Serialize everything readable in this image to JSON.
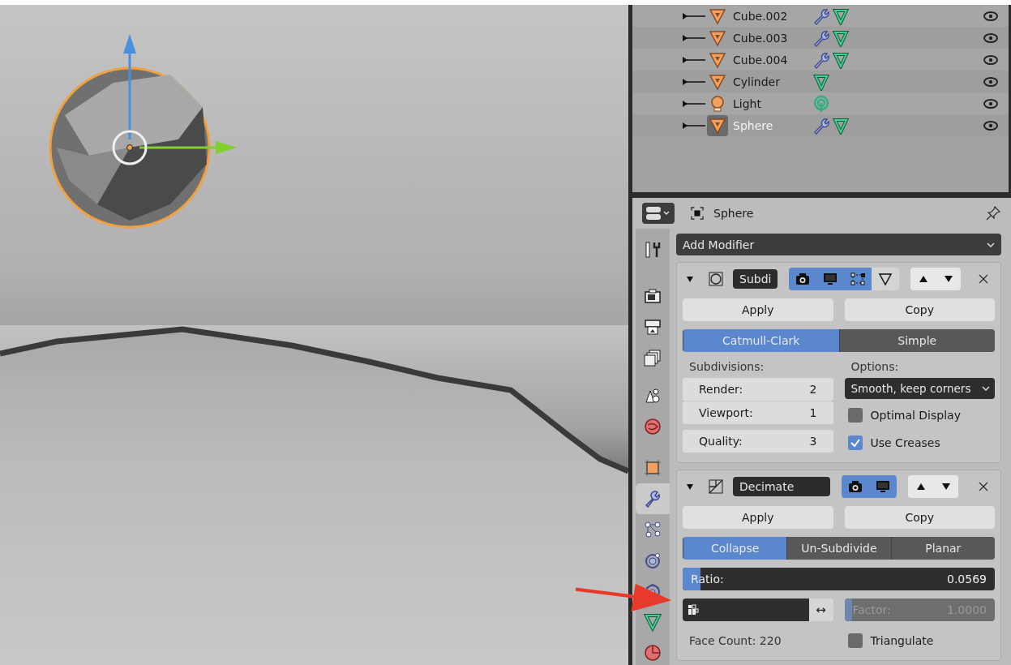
{
  "outliner": {
    "items": [
      {
        "name": "Cube.002",
        "kind": "mesh",
        "modifiers": true,
        "selected": false
      },
      {
        "name": "Cube.003",
        "kind": "mesh",
        "modifiers": true,
        "selected": false
      },
      {
        "name": "Cube.004",
        "kind": "mesh",
        "modifiers": true,
        "selected": false
      },
      {
        "name": "Cylinder",
        "kind": "mesh",
        "modifiers": false,
        "selected": false
      },
      {
        "name": "Light",
        "kind": "light",
        "modifiers": false,
        "selected": false
      },
      {
        "name": "Sphere",
        "kind": "mesh",
        "modifiers": true,
        "selected": true
      }
    ]
  },
  "properties": {
    "object_name": "Sphere",
    "tabs": [
      {
        "kind": "tool",
        "selected": false
      },
      {
        "kind": "render",
        "selected": false
      },
      {
        "kind": "output",
        "selected": false
      },
      {
        "kind": "layers",
        "selected": false
      },
      {
        "kind": "scene",
        "selected": false
      },
      {
        "kind": "world",
        "selected": false
      },
      {
        "kind": "object",
        "selected": false
      },
      {
        "kind": "modifier",
        "selected": true
      },
      {
        "kind": "particles",
        "selected": false
      },
      {
        "kind": "physics",
        "selected": false
      },
      {
        "kind": "constraint",
        "selected": false
      },
      {
        "kind": "data",
        "selected": false
      },
      {
        "kind": "material",
        "selected": false
      }
    ],
    "add_modifier": "Add Modifier",
    "modifiers": [
      {
        "kind": "subdivision",
        "name": "Subdi",
        "toggles": [
          {
            "kind": "render",
            "on": true
          },
          {
            "kind": "viewport",
            "on": true
          },
          {
            "kind": "editmode",
            "on": true
          },
          {
            "kind": "cage",
            "on": false
          }
        ],
        "apply": "Apply",
        "copy": "Copy",
        "modes": [
          {
            "label": "Catmull-Clark",
            "selected": true
          },
          {
            "label": "Simple",
            "selected": false
          }
        ],
        "subdivisions_label": "Subdivisions:",
        "fields": [
          {
            "label": "Render:",
            "value": "2"
          },
          {
            "label": "Viewport:",
            "value": "1"
          },
          {
            "label": "Quality:",
            "value": "3"
          }
        ],
        "options_label": "Options:",
        "options_dropdown": "Smooth, keep corners",
        "checkboxes": [
          {
            "label": "Optimal Display",
            "checked": false
          },
          {
            "label": "Use Creases",
            "checked": true
          }
        ]
      },
      {
        "kind": "decimate",
        "name": "Decimate",
        "toggles": [
          {
            "kind": "render",
            "on": true
          },
          {
            "kind": "viewport",
            "on": true
          }
        ],
        "apply": "Apply",
        "copy": "Copy",
        "modes": [
          {
            "label": "Collapse",
            "selected": true
          },
          {
            "label": "Un-Subdivide",
            "selected": false
          },
          {
            "label": "Planar",
            "selected": false
          }
        ],
        "ratio": {
          "label": "Ratio:",
          "value": "0.0569",
          "level": 0.0569
        },
        "invert_button": "↔",
        "factor": {
          "label": "Factor:",
          "value": "1.0000",
          "level": 0.05,
          "disabled": true
        },
        "face_count": "Face Count: 220",
        "checkboxes": [
          {
            "label": "Triangulate",
            "checked": false
          }
        ]
      }
    ]
  }
}
